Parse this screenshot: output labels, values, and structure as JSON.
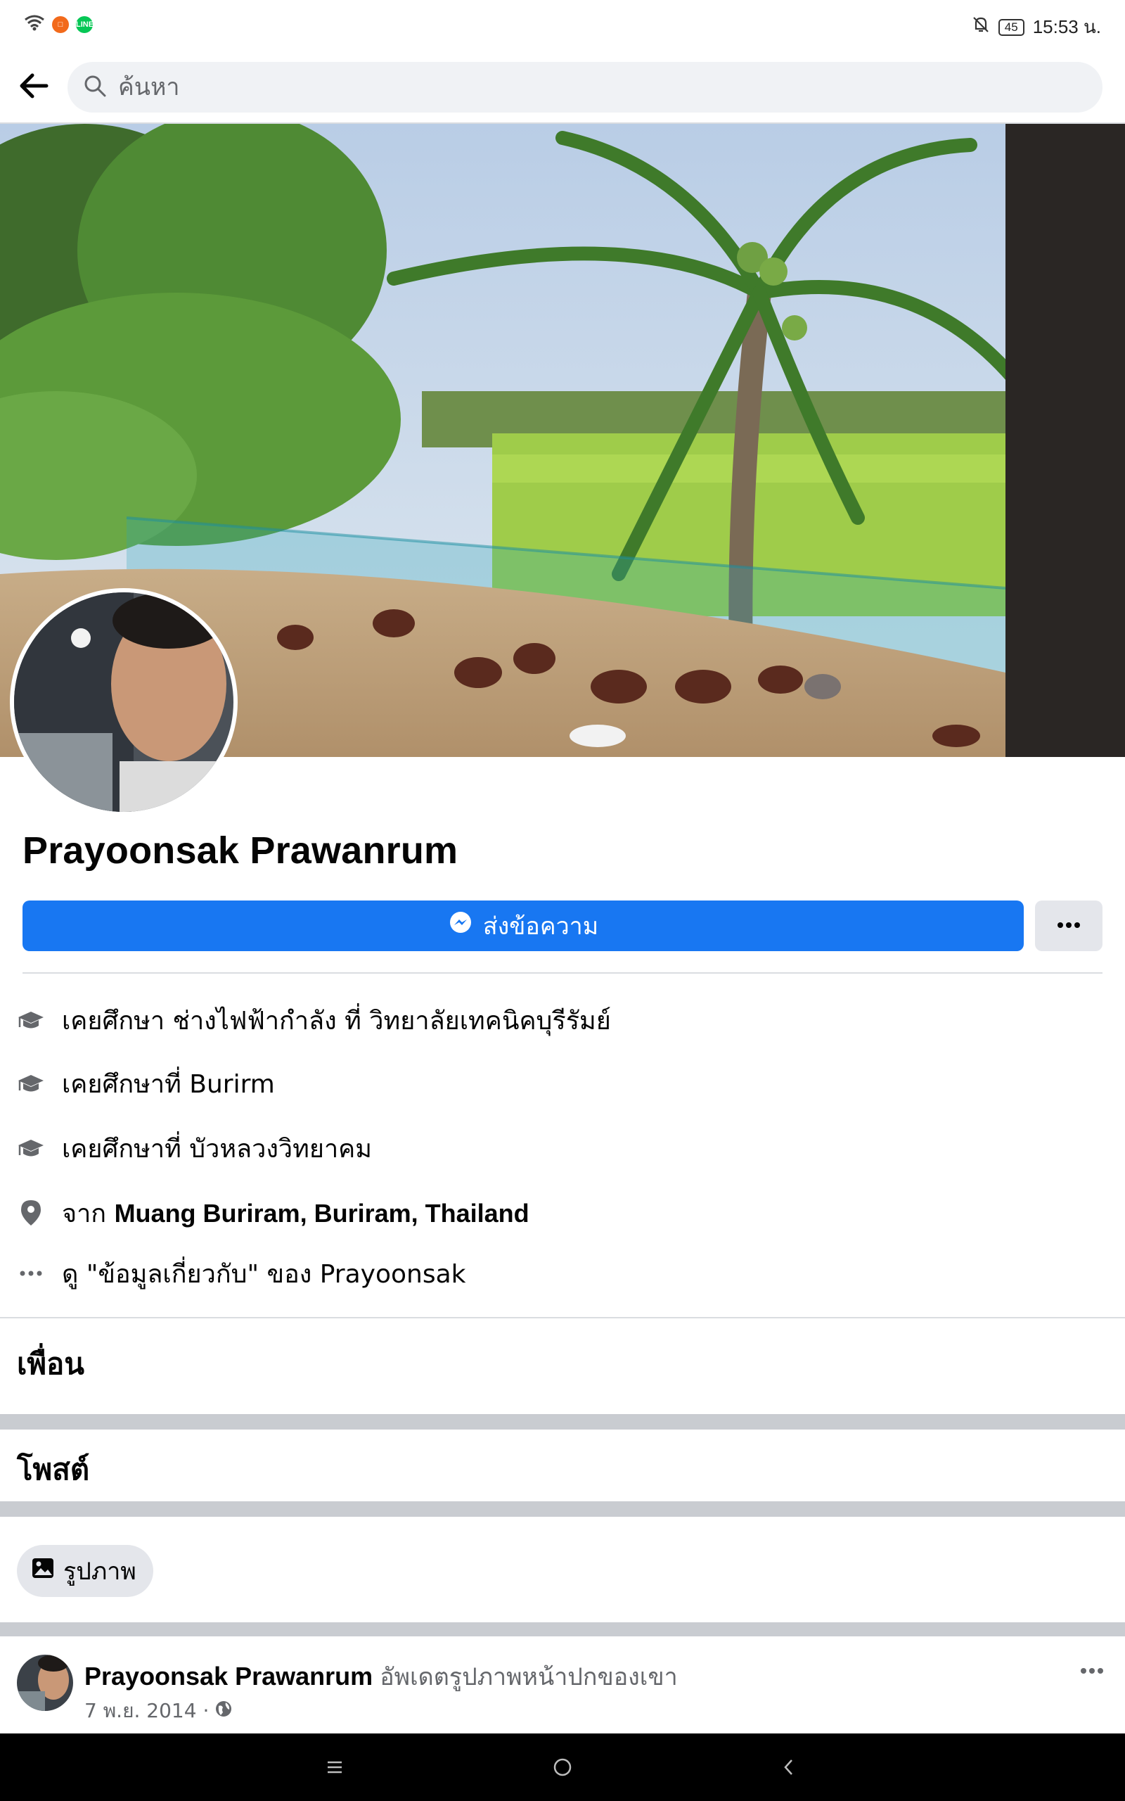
{
  "status_bar": {
    "time": "15:53 น.",
    "battery": "45",
    "app_icons": [
      "wifi-icon",
      "app-orange-icon",
      "line-app-icon"
    ],
    "line_label": "LINE"
  },
  "search": {
    "placeholder": "ค้นหา"
  },
  "profile": {
    "name": "Prayoonsak Prawanrum",
    "message_button": "ส่งข้อความ",
    "accent_color": "#1877f2"
  },
  "info": {
    "items": [
      {
        "icon": "graduation-cap-icon",
        "text": "เคยศึกษา ช่างไฟฟ้ากำลัง ที่ วิทยาลัยเทคนิคบุรีรัมย์"
      },
      {
        "icon": "graduation-cap-icon",
        "text": "เคยศึกษาที่ Burirm"
      },
      {
        "icon": "graduation-cap-icon",
        "text": "เคยศึกษาที่ บัวหลวงวิทยาคม"
      }
    ],
    "from_prefix": "จาก",
    "from_place": "Muang Buriram, Buriram, Thailand",
    "about_link": "ดู \"ข้อมูลเกี่ยวกับ\" ของ Prayoonsak"
  },
  "sections": {
    "friends": "เพื่อน",
    "posts": "โพสต์",
    "photos_chip": "รูปภาพ"
  },
  "post": {
    "author": "Prayoonsak Prawanrum",
    "action": "อัพเดตรูปภาพหน้าปกของเขา",
    "date": "7 พ.ย. 2014 ·",
    "privacy": "globe-icon"
  },
  "nav": {
    "buttons": [
      "menu-icon",
      "home-circle-icon",
      "back-chevron-icon"
    ]
  }
}
